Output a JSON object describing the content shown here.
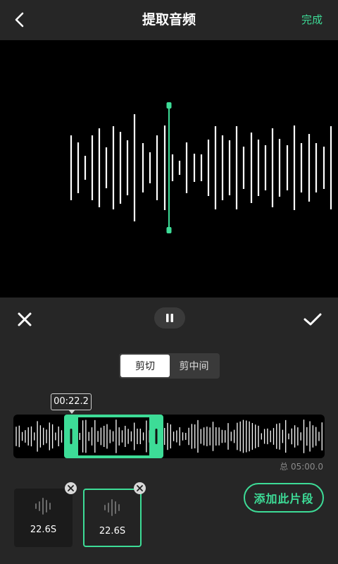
{
  "header": {
    "title": "提取音频",
    "done_label": "完成",
    "back_icon": "chevron-left-icon"
  },
  "colors": {
    "accent": "#3ddc97",
    "background": "#262626",
    "wave_background": "#000000"
  },
  "controls": {
    "close_icon": "close-icon",
    "pause_icon": "pause-icon",
    "confirm_icon": "checkmark-icon"
  },
  "mode_toggle": {
    "options": [
      "剪切",
      "剪中间"
    ],
    "selected": "剪切"
  },
  "timeline": {
    "current_time": "00:22.2",
    "total_time": "总 05:00.0"
  },
  "clips": [
    {
      "duration": "22.6S",
      "selected": false
    },
    {
      "duration": "22.6S",
      "selected": true
    }
  ],
  "add_segment_label": "添加此片段"
}
